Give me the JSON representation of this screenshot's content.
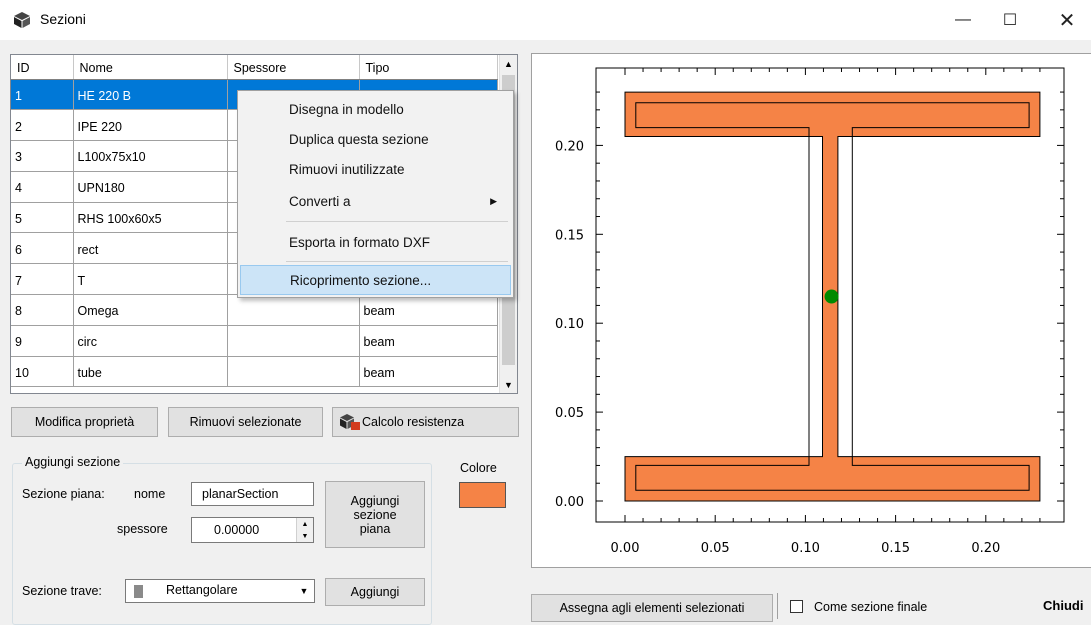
{
  "window": {
    "title": "Sezioni",
    "controls": {
      "minimize": "—",
      "maximize": "☐",
      "close": "✕"
    },
    "app_icon": "cube-icon"
  },
  "grid": {
    "columns": [
      "ID",
      "Nome",
      "Spessore",
      "Tipo"
    ],
    "rows": [
      {
        "id": "1",
        "name": "HE 220 B",
        "thickness": "",
        "type": ""
      },
      {
        "id": "2",
        "name": "IPE 220",
        "thickness": "",
        "type": ""
      },
      {
        "id": "3",
        "name": "L100x75x10",
        "thickness": "",
        "type": ""
      },
      {
        "id": "4",
        "name": "UPN180",
        "thickness": "",
        "type": ""
      },
      {
        "id": "5",
        "name": "RHS 100x60x5",
        "thickness": "",
        "type": ""
      },
      {
        "id": "6",
        "name": "rect",
        "thickness": "",
        "type": ""
      },
      {
        "id": "7",
        "name": "T",
        "thickness": "",
        "type": ""
      },
      {
        "id": "8",
        "name": "Omega",
        "thickness": "",
        "type": "beam"
      },
      {
        "id": "9",
        "name": "circ",
        "thickness": "",
        "type": "beam"
      },
      {
        "id": "10",
        "name": "tube",
        "thickness": "",
        "type": "beam"
      }
    ],
    "selected_row": "1"
  },
  "context_menu": {
    "items": [
      "Disegna in modello",
      "Duplica questa sezione",
      "Rimuovi inutilizzate",
      "Converti a",
      "Esporta in formato DXF",
      "Ricoprimento sezione..."
    ],
    "highlighted": "Ricoprimento sezione..."
  },
  "buttons": {
    "modify": "Modifica proprietà",
    "remove_selected": "Rimuovi selezionate",
    "resistance": "Calcolo resistenza",
    "add_planar": [
      "Aggiungi",
      "sezione",
      "piana"
    ],
    "add": "Aggiungi",
    "assign": "Assegna agli elementi selezionati",
    "close": "Chiudi"
  },
  "add_section": {
    "group_title": "Aggiungi sezione",
    "planar_label": "Sezione piana:",
    "name_label": "nome",
    "name_value": "planarSection",
    "thickness_label": "spessore",
    "thickness_value": "0.00000",
    "color_label": "Colore",
    "color_value": "#f58346",
    "beam_label": "Sezione trave:",
    "beam_value": "Rettangolare"
  },
  "final_section": {
    "label": "Come sezione finale",
    "checked": false
  },
  "chart_data": {
    "type": "area",
    "title": "",
    "xlabel": "",
    "ylabel": "",
    "x_ticks": [
      "0.00",
      "0.05",
      "0.10",
      "0.15",
      "0.20"
    ],
    "y_ticks": [
      "0.00",
      "0.05",
      "0.10",
      "0.15",
      "0.20"
    ],
    "xlim": [
      0.0,
      0.23
    ],
    "ylim": [
      0.0,
      0.23
    ],
    "fill_color": "#f58346",
    "outer_outline": [
      [
        0,
        0
      ],
      [
        0.23,
        0
      ],
      [
        0.23,
        0.025
      ],
      [
        0.118,
        0.025
      ],
      [
        0.118,
        0.205
      ],
      [
        0.23,
        0.205
      ],
      [
        0.23,
        0.23
      ],
      [
        0,
        0.23
      ],
      [
        0,
        0.205
      ],
      [
        0.1095,
        0.205
      ],
      [
        0.1095,
        0.025
      ],
      [
        0,
        0.025
      ]
    ],
    "inner_outline": [
      [
        0.006,
        0.006
      ],
      [
        0.224,
        0.006
      ],
      [
        0.224,
        0.02
      ],
      [
        0.126,
        0.02
      ],
      [
        0.126,
        0.21
      ],
      [
        0.224,
        0.21
      ],
      [
        0.224,
        0.224
      ],
      [
        0.006,
        0.224
      ],
      [
        0.006,
        0.21
      ],
      [
        0.102,
        0.21
      ],
      [
        0.102,
        0.02
      ],
      [
        0.006,
        0.02
      ]
    ],
    "centroid": [
      0.1145,
      0.115
    ],
    "centroid_color": "#008a00"
  }
}
